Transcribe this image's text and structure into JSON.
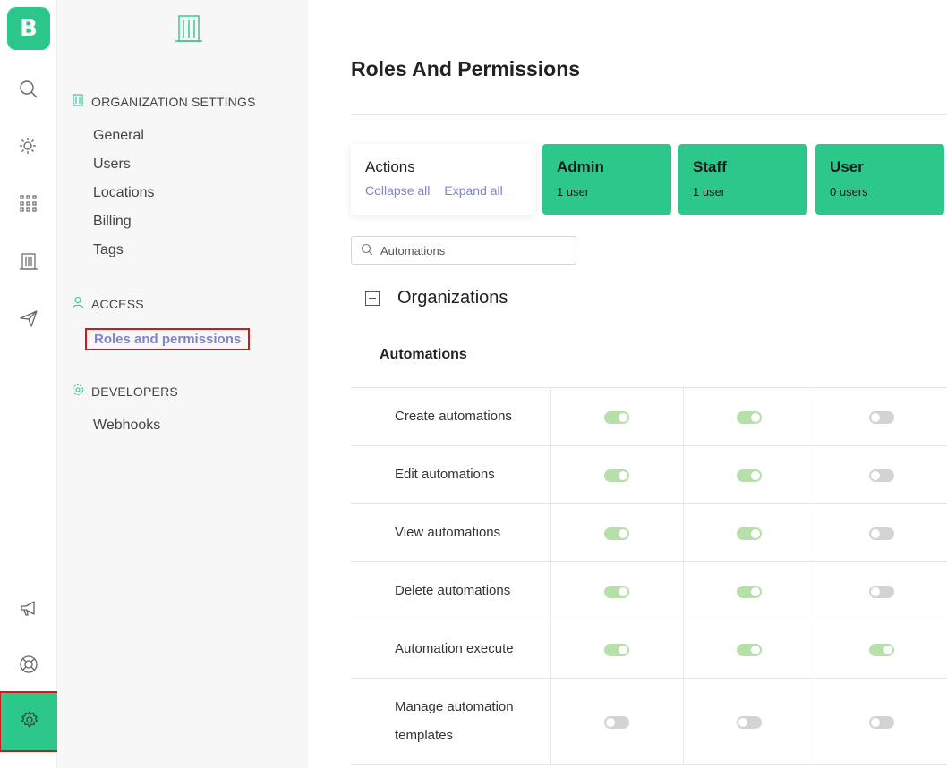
{
  "rail": {
    "logo_letter": "B",
    "icons": [
      "search-icon",
      "sun-icon",
      "apps-grid-icon",
      "building-icon",
      "send-icon",
      "megaphone-icon",
      "lifebuoy-icon",
      "gear-icon"
    ]
  },
  "panel": {
    "sections": [
      {
        "title": "ORGANIZATION SETTINGS",
        "items": [
          "General",
          "Users",
          "Locations",
          "Billing",
          "Tags"
        ]
      },
      {
        "title": "ACCESS",
        "items": [
          "Roles and permissions"
        ]
      },
      {
        "title": "DEVELOPERS",
        "items": [
          "Webhooks"
        ]
      }
    ]
  },
  "main": {
    "title": "Roles And Permissions",
    "actions": {
      "title": "Actions",
      "collapse_all": "Collapse all",
      "expand_all": "Expand all"
    },
    "roles": [
      {
        "name": "Admin",
        "count": "1 user"
      },
      {
        "name": "Staff",
        "count": "1 user"
      },
      {
        "name": "User",
        "count": "0 users"
      }
    ],
    "search": {
      "value": "Automations",
      "placeholder": "Search"
    },
    "organization_title": "Organizations",
    "group_title": "Automations",
    "permissions": [
      {
        "label": "Create automations",
        "values": [
          true,
          true,
          false
        ]
      },
      {
        "label": "Edit automations",
        "values": [
          true,
          true,
          false
        ]
      },
      {
        "label": "View automations",
        "values": [
          true,
          true,
          false
        ]
      },
      {
        "label": "Delete automations",
        "values": [
          true,
          true,
          false
        ]
      },
      {
        "label": "Automation execute",
        "values": [
          true,
          true,
          true
        ]
      },
      {
        "label": "Manage automation templates",
        "values": [
          false,
          false,
          false
        ]
      }
    ]
  },
  "colors": {
    "accent": "#2bc78b",
    "link": "#7d84c7",
    "toggle_on": "#b6dfa9",
    "toggle_off": "#d3d3d3",
    "highlight": "#d01a1a"
  }
}
